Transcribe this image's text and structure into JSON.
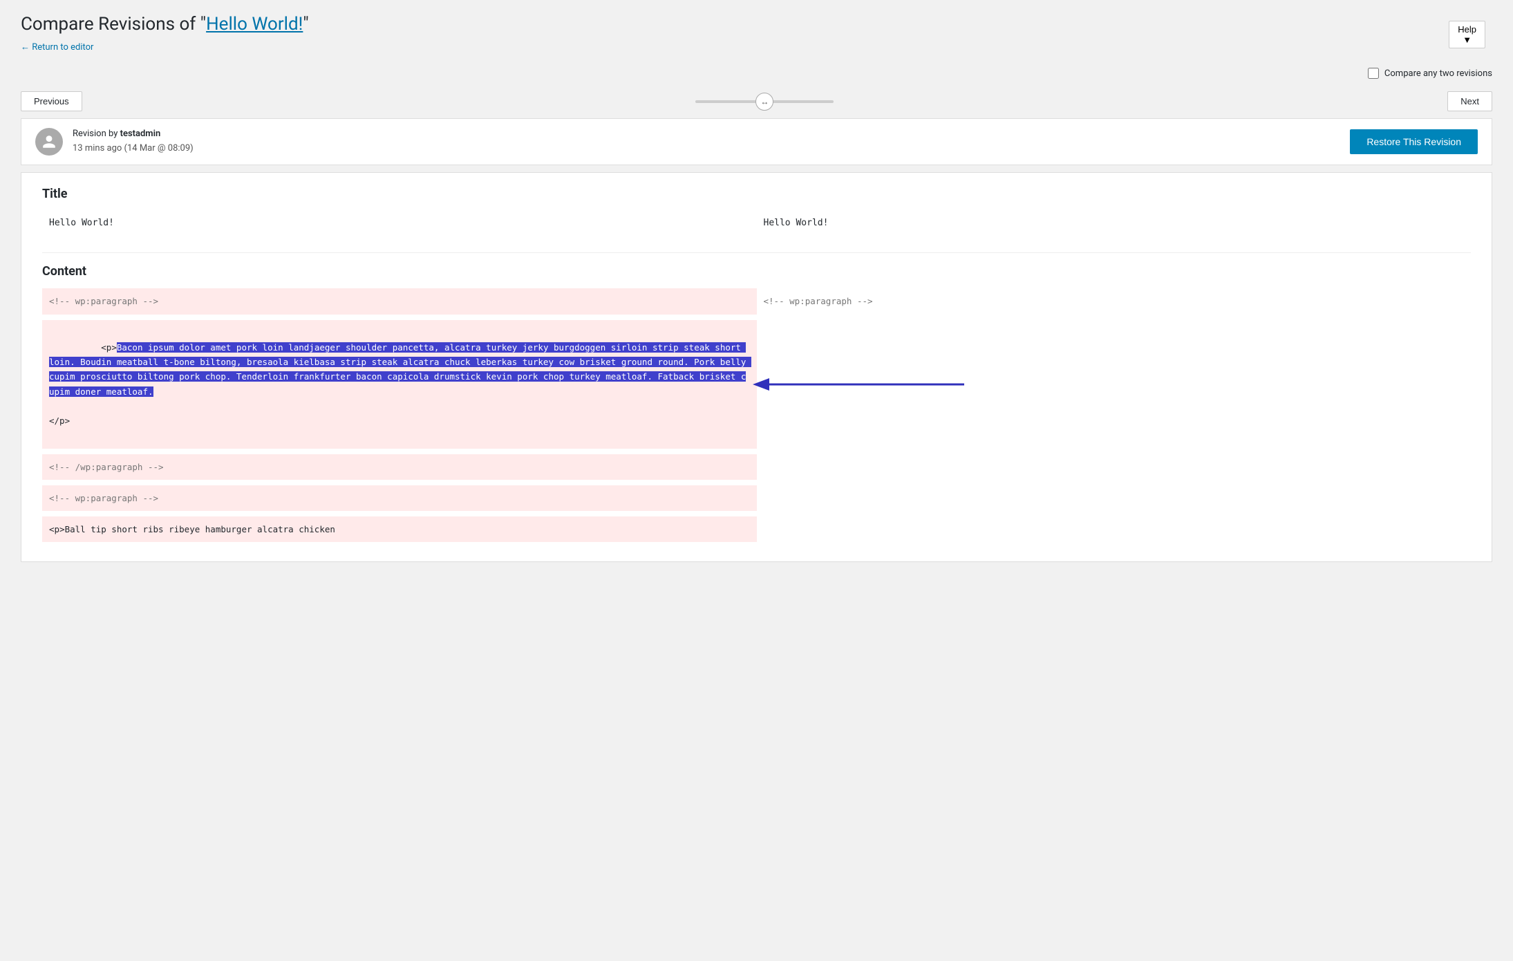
{
  "header": {
    "title_prefix": "Compare Revisions of \"",
    "title_link_text": "Hello World!",
    "title_suffix": "\"",
    "return_link": "← Return to editor",
    "help_button": "Help ▼"
  },
  "compare_any": {
    "label": "Compare any two revisions"
  },
  "navigation": {
    "previous_label": "Previous",
    "next_label": "Next"
  },
  "revision": {
    "author_label": "Revision by ",
    "author_name": "testadmin",
    "time_ago": "13 mins ago",
    "date": "(14 Mar @ 08:09)",
    "restore_button": "Restore This Revision"
  },
  "diff": {
    "title_section_label": "Title",
    "title_left": "Hello World!",
    "title_right": "Hello World!",
    "content_section_label": "Content",
    "wp_paragraph_comment": "<!-- wp:paragraph -->",
    "wp_paragraph_comment_right": "<!-- wp:paragraph -->",
    "wp_paragraph_end_comment": "<!-- /wp:paragraph -->",
    "wp_paragraph2_comment": "<!-- wp:paragraph -->",
    "removed_text_before": "<p>",
    "removed_text_highlighted": "Bacon ipsum dolor amet pork loin landjaeger shoulder pancetta, alcatra turkey jerky burgdoggen sirloin strip steak short loin. Boudin meatball t-bone biltong, bresaola kielbasa strip steak alcatra chuck leberkas turkey cow brisket ground round. Pork belly cupim prosciutto biltong pork chop. Tenderloin frankfurter bacon capicola drumstick kevin pork chop turkey meatloaf. Fatback brisket cupim doner meatloaf.",
    "removed_text_after": "\n</p>",
    "ball_tip_text": "<p>Ball tip short ribs ribeye hamburger alcatra chicken"
  }
}
